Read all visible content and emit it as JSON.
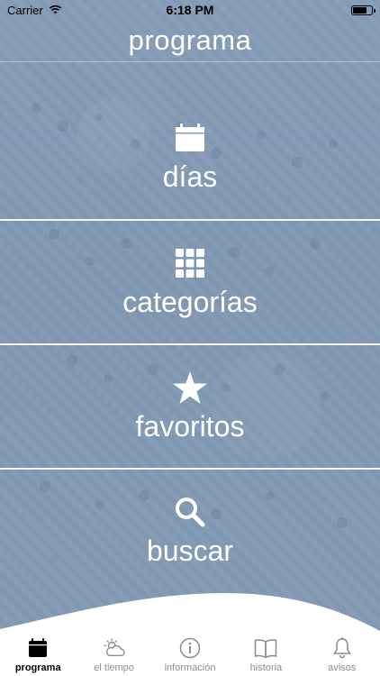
{
  "status_bar": {
    "carrier": "Carrier",
    "time": "6:18 PM"
  },
  "header": {
    "title": "programa"
  },
  "menu": {
    "items": [
      {
        "label": "días",
        "icon": "calendar-icon"
      },
      {
        "label": "categorías",
        "icon": "grid-icon"
      },
      {
        "label": "favoritos",
        "icon": "star-icon"
      },
      {
        "label": "buscar",
        "icon": "search-icon"
      }
    ]
  },
  "tab_bar": {
    "active_color": "#000000",
    "inactive_color": "#8c8c8c",
    "tabs": [
      {
        "label": "programa",
        "icon": "calendar-icon",
        "active": true
      },
      {
        "label": "el tiempo",
        "icon": "weather-icon",
        "active": false
      },
      {
        "label": "información",
        "icon": "info-icon",
        "active": false
      },
      {
        "label": "historia",
        "icon": "book-icon",
        "active": false
      },
      {
        "label": "avisos",
        "icon": "bell-icon",
        "active": false
      }
    ]
  }
}
